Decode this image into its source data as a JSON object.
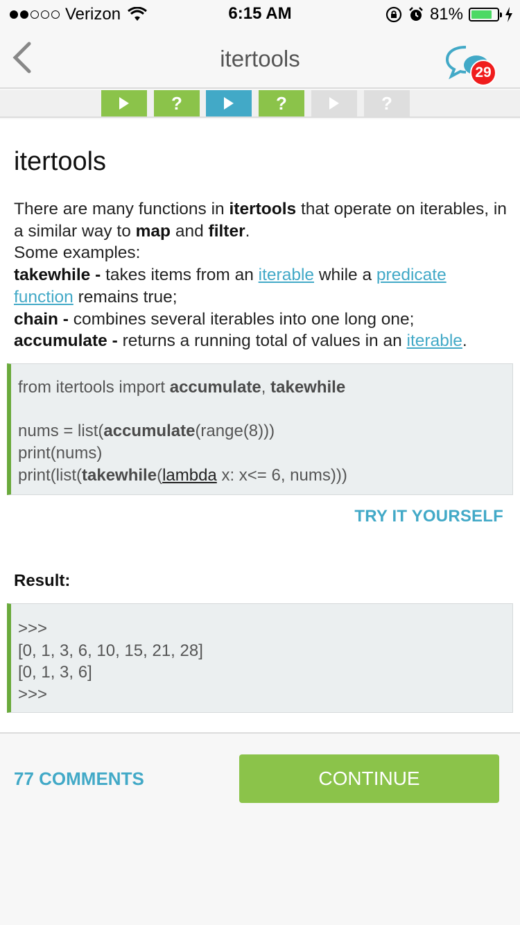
{
  "status_bar": {
    "carrier": "Verizon",
    "time": "6:15 AM",
    "battery": "81%",
    "battery_level": 0.81,
    "signal_bars": 2
  },
  "nav": {
    "title": "itertools",
    "badge_count": "29"
  },
  "progress_steps": [
    {
      "type": "play",
      "state": "completed"
    },
    {
      "type": "quiz",
      "state": "completed",
      "symbol": "?"
    },
    {
      "type": "play",
      "state": "current"
    },
    {
      "type": "quiz",
      "state": "completed",
      "symbol": "?"
    },
    {
      "type": "play",
      "state": "locked"
    },
    {
      "type": "quiz",
      "state": "locked",
      "symbol": "?"
    }
  ],
  "lesson": {
    "title": "itertools",
    "p1_a": "There are many functions in ",
    "p1_b": "itertools",
    "p1_c": " that operate on iterables, in a similar way to ",
    "p1_d": "map",
    "p1_e": " and ",
    "p1_f": "filter",
    "p1_g": ".",
    "p2": "Some examples:",
    "tw_name": "takewhile -",
    "tw_a": " takes items from an ",
    "tw_link1": "iterable",
    "tw_b": " while a ",
    "tw_link2": "predicate function",
    "tw_c": " remains true;",
    "ch_name": "chain -",
    "ch_a": " combines several iterables into one long one;",
    "ac_name": "accumulate -",
    "ac_a": " returns a running total of values in an ",
    "ac_link": "iterable",
    "ac_b": "."
  },
  "code": {
    "l1_a": "from itertools import ",
    "l1_b": "accumulate",
    "l1_c": ", ",
    "l1_d": "takewhile",
    "l2_a": "nums = list(",
    "l2_b": "accumulate",
    "l2_c": "(range(8)))",
    "l3": "print(nums)",
    "l4_a": "print(list(",
    "l4_b": "takewhile",
    "l4_c": "(",
    "l4_d": "lambda",
    "l4_e": " x: x<= 6, nums)))"
  },
  "try_label": "TRY IT YOURSELF",
  "result_label": "Result:",
  "result_lines": [
    ">>>",
    "[0, 1, 3, 6, 10, 15, 21, 28]",
    "[0, 1, 3, 6]",
    ">>>"
  ],
  "footer": {
    "comments": "77 COMMENTS",
    "continue": "CONTINUE"
  },
  "colors": {
    "accent_blue": "#42a9c7",
    "accent_green": "#8bc34a",
    "badge_red": "#f01d1d"
  }
}
